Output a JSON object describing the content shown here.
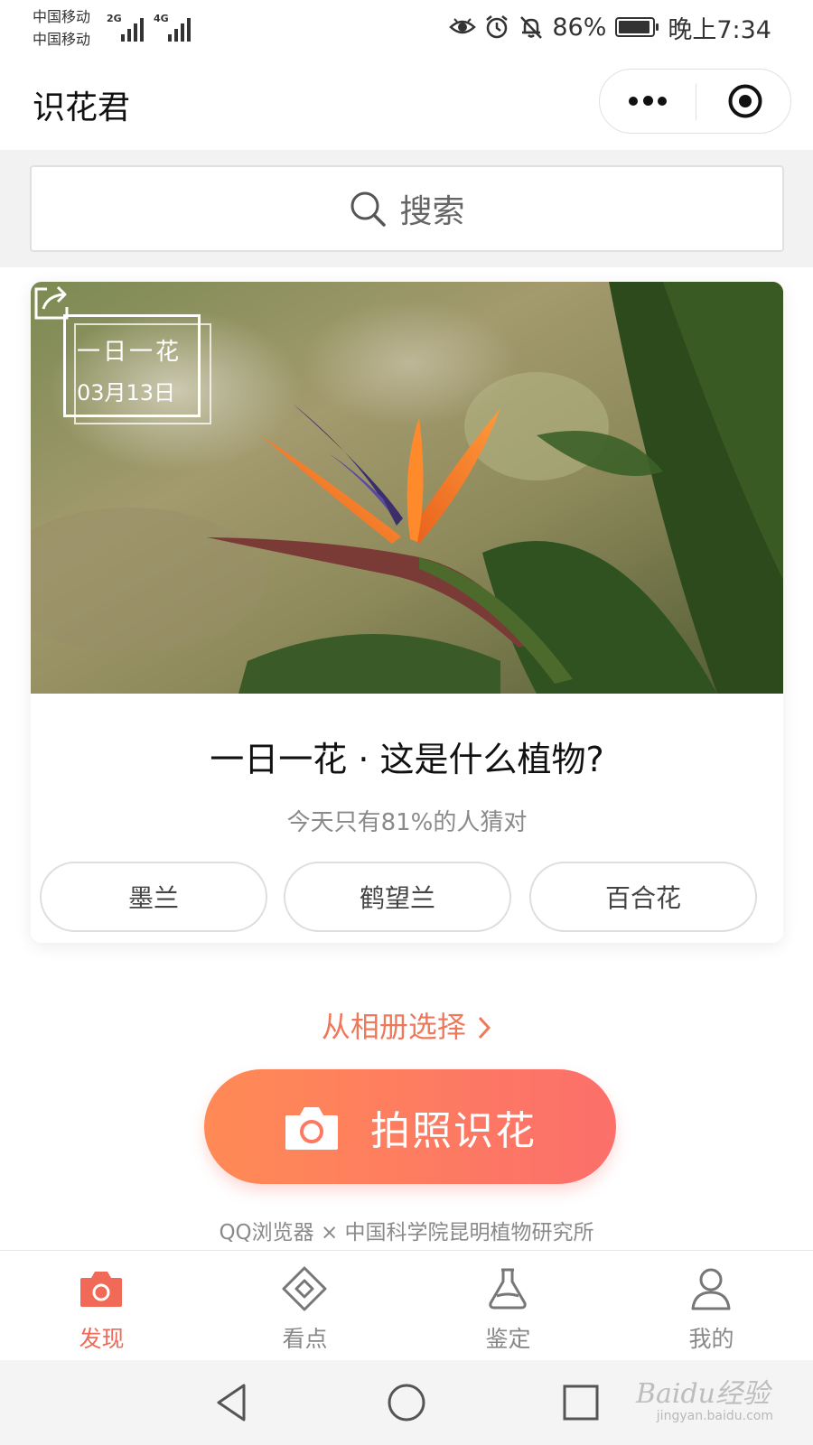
{
  "status_bar": {
    "carrier1": "中国移动",
    "carrier2": "中国移动",
    "net1": "2G",
    "net2": "4G",
    "battery": "86%",
    "time": "晚上7:34",
    "icons": [
      "eye-icon",
      "alarm-icon",
      "silent-icon",
      "battery-icon"
    ]
  },
  "title_bar": {
    "title": "识花君",
    "more_icon": "more-dots-icon",
    "close_icon": "target-close-icon"
  },
  "search": {
    "placeholder": "搜索",
    "icon": "search-icon"
  },
  "daily_flower_card": {
    "tag_title": "一日一花",
    "tag_date": "03月13日",
    "share_icon": "share-icon",
    "question": "一日一花 · 这是什么植物?",
    "subtitle": "今天只有81%的人猜对",
    "options": [
      {
        "label": "墨兰"
      },
      {
        "label": "鹤望兰"
      },
      {
        "label": "百合花"
      }
    ]
  },
  "actions": {
    "album_link": "从相册选择",
    "camera_button": "拍照识花",
    "credit": "QQ浏览器 × 中国科学院昆明植物研究所"
  },
  "tab_bar": {
    "tabs": [
      {
        "label": "发现",
        "icon": "camera-icon",
        "active": true
      },
      {
        "label": "看点",
        "icon": "diamond-icon",
        "active": false
      },
      {
        "label": "鉴定",
        "icon": "flask-icon",
        "active": false
      },
      {
        "label": "我的",
        "icon": "user-icon",
        "active": false
      }
    ]
  },
  "system_nav": {
    "icons": [
      "back-triangle-icon",
      "home-circle-icon",
      "recent-square-icon"
    ]
  },
  "watermark": {
    "brand": "Baidu经验",
    "url": "jingyan.baidu.com"
  },
  "colors": {
    "accent": "#f06a57",
    "button_start": "#ff8a55",
    "button_end": "#fc6f6b",
    "background": "#f2f2f2"
  }
}
